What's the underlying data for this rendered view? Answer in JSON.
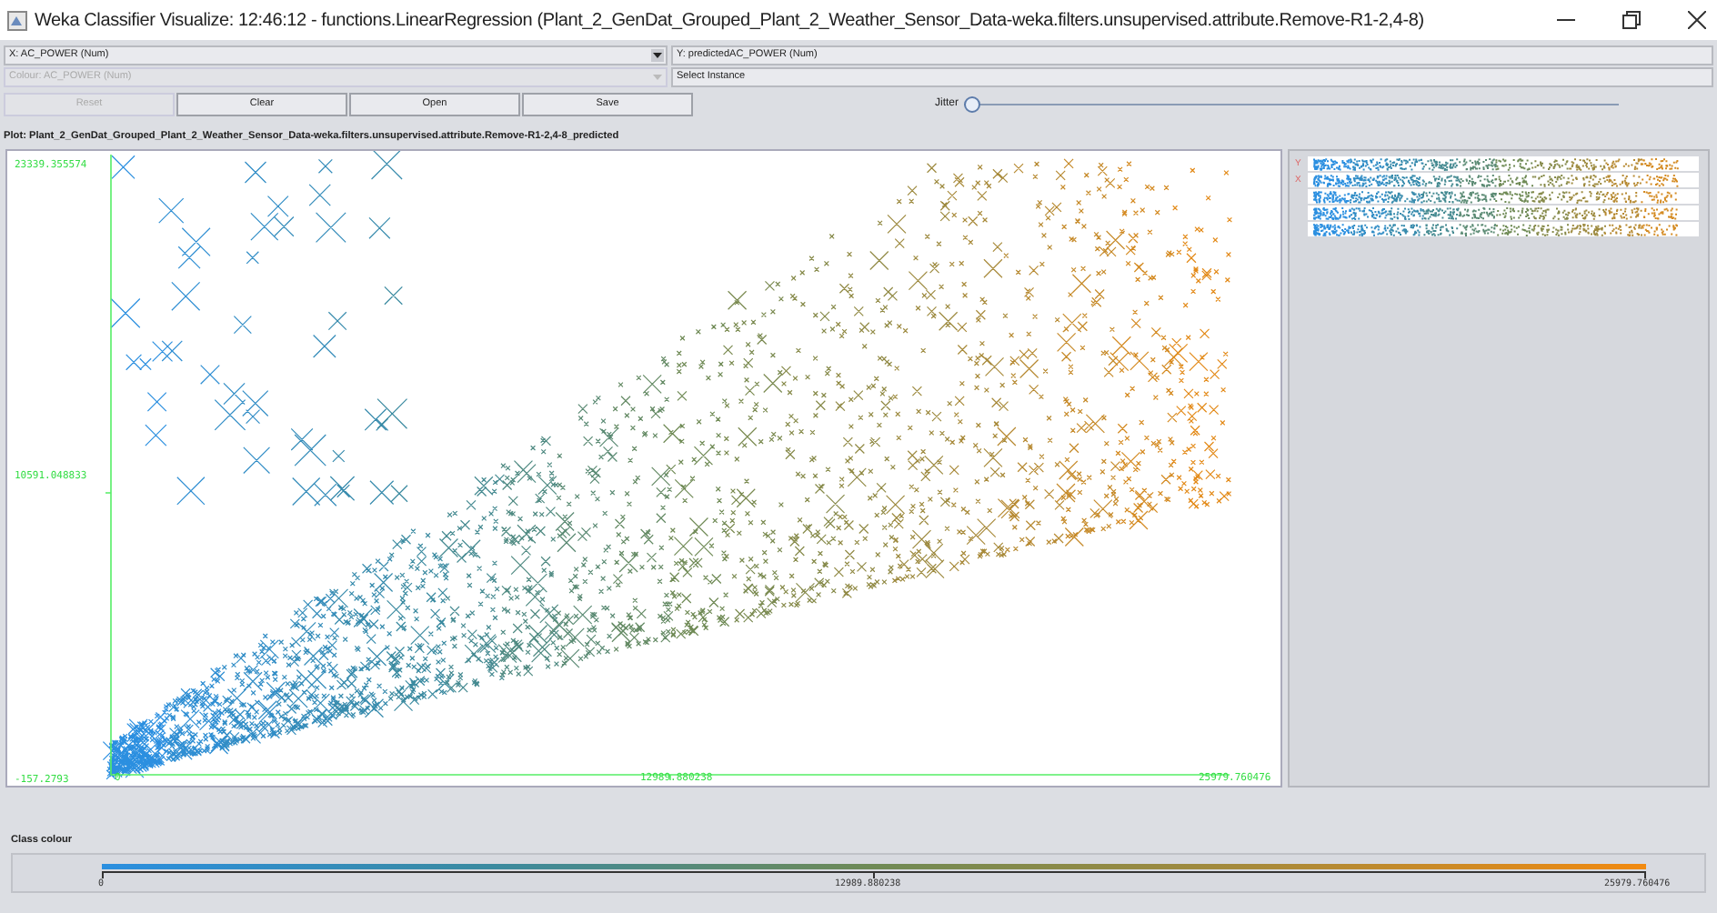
{
  "window": {
    "title": "Weka Classifier Visualize: 12:46:12 - functions.LinearRegression (Plant_2_GenDat_Grouped_Plant_2_Weather_Sensor_Data-weka.filters.unsupervised.attribute.Remove-R1-2,4-8)"
  },
  "selectors": [
    {
      "label": "X: AC_POWER (Num)",
      "disabled": false
    },
    {
      "label": "Y: predictedAC_POWER (Num)",
      "disabled": false
    },
    {
      "label": "Colour: AC_POWER (Num)",
      "disabled": true
    },
    {
      "label": "Select Instance",
      "disabled": false
    }
  ],
  "buttons": [
    {
      "label": "Reset",
      "disabled": true
    },
    {
      "label": "Clear",
      "disabled": false
    },
    {
      "label": "Open",
      "disabled": false
    },
    {
      "label": "Save",
      "disabled": false
    }
  ],
  "jitter": {
    "label": "Jitter",
    "level": 0
  },
  "plot": {
    "title": "Plot: Plant_2_GenDat_Grouped_Plant_2_Weather_Sensor_Data-weka.filters.unsupervised.attribute.Remove-R1-2,4-8_predicted",
    "y_labels": [
      "23339.355574",
      "10591.048833",
      "-157.2793"
    ],
    "x_labels": [
      "0",
      "12989.880238",
      "25979.760476"
    ]
  },
  "strip_tags": [
    "Y",
    "X"
  ],
  "class_colour": {
    "title": "Class colour",
    "ticks": [
      "0",
      "12989.880238",
      "25979.760476"
    ]
  }
}
